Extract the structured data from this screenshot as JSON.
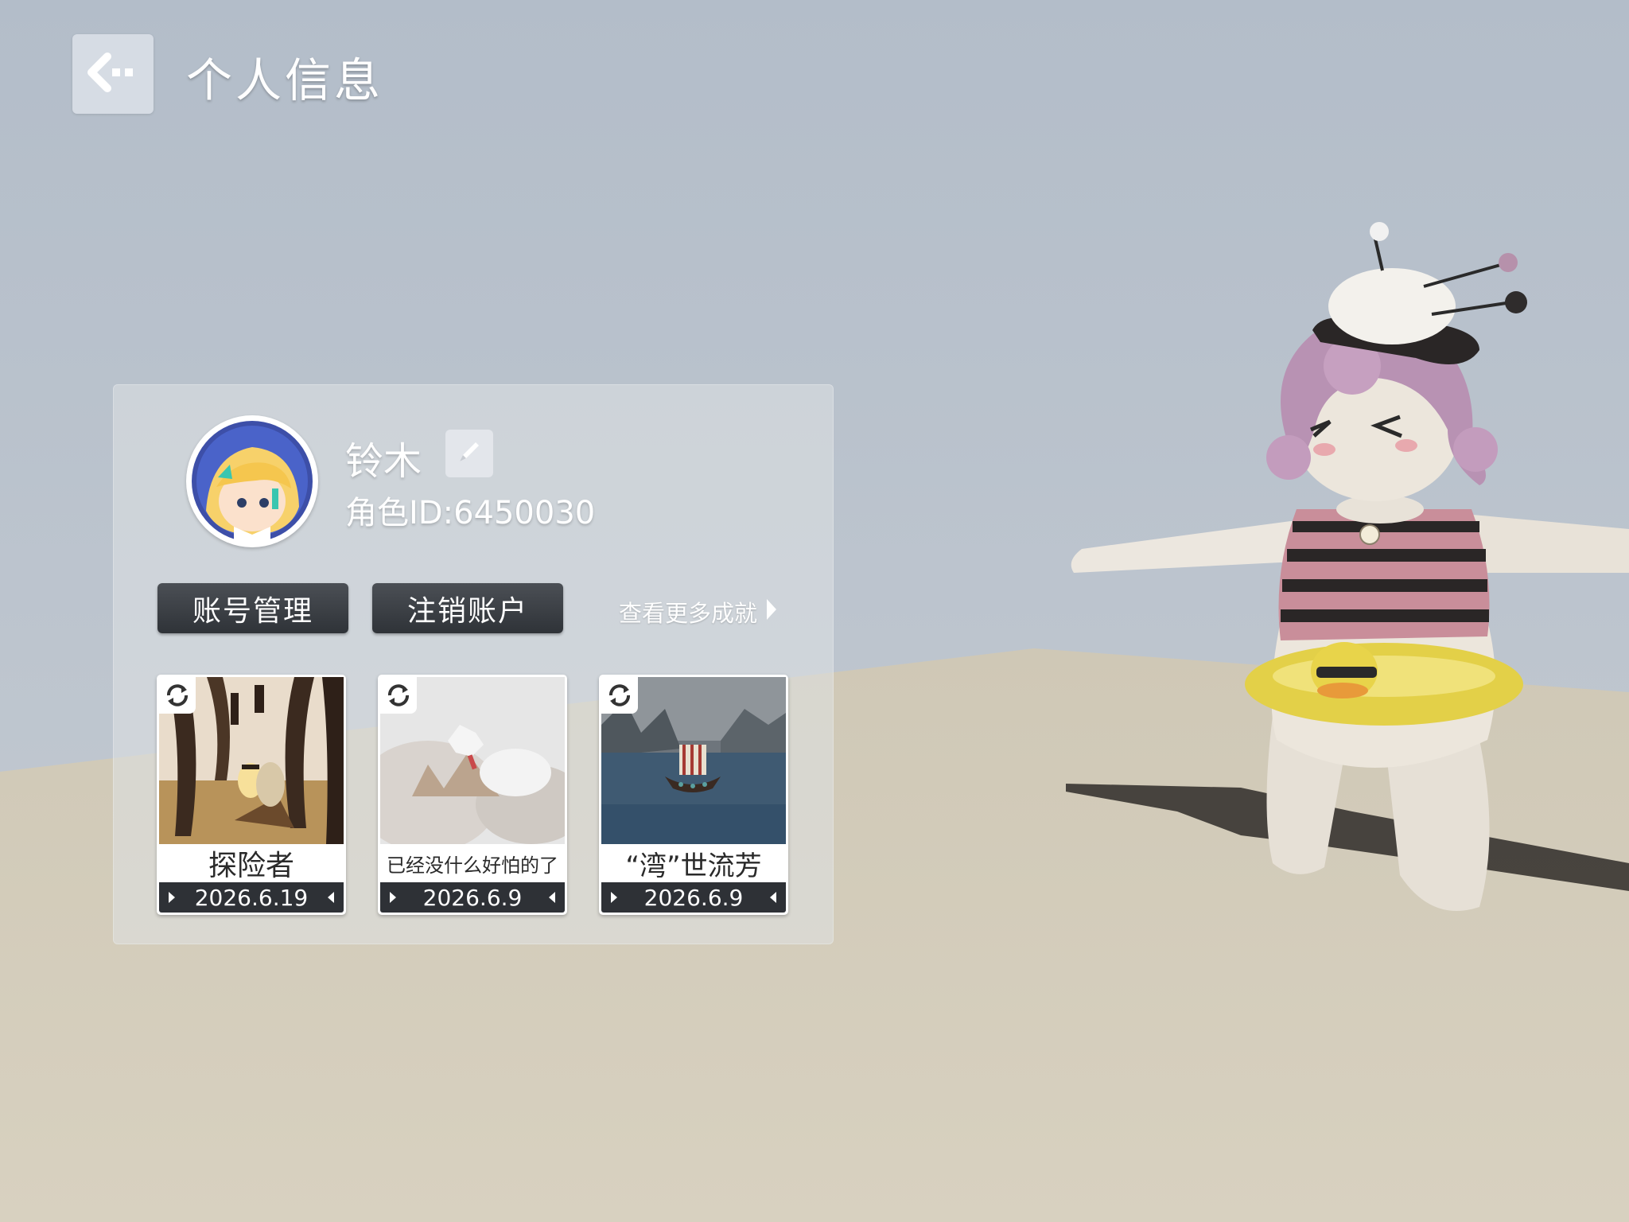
{
  "header": {
    "back_icon": "back-arrow-icon",
    "title": "个人信息"
  },
  "profile": {
    "username": "铃木",
    "edit_icon": "pencil-icon",
    "role_id": "角色ID:6450030"
  },
  "actions": {
    "account_manage": "账号管理",
    "cancel_account": "注销账户",
    "more_achievements": "查看更多成就"
  },
  "achievements": [
    {
      "title": "探险者",
      "date": "2026.6.19",
      "thumb": "cave-lantern-scene"
    },
    {
      "title": "已经没什么好怕的了",
      "date": "2026.6.9",
      "thumb": "falling-figure-scene"
    },
    {
      "title": "“湾”世流芳",
      "date": "2026.6.9",
      "thumb": "viking-ship-scene"
    }
  ],
  "colors": {
    "sky": "#b9c2cd",
    "ground": "#d6cfbd",
    "button_dark": "#2f3338",
    "shirt_stripe_pink": "#c98e9a",
    "ring_yellow": "#e6d44a"
  }
}
